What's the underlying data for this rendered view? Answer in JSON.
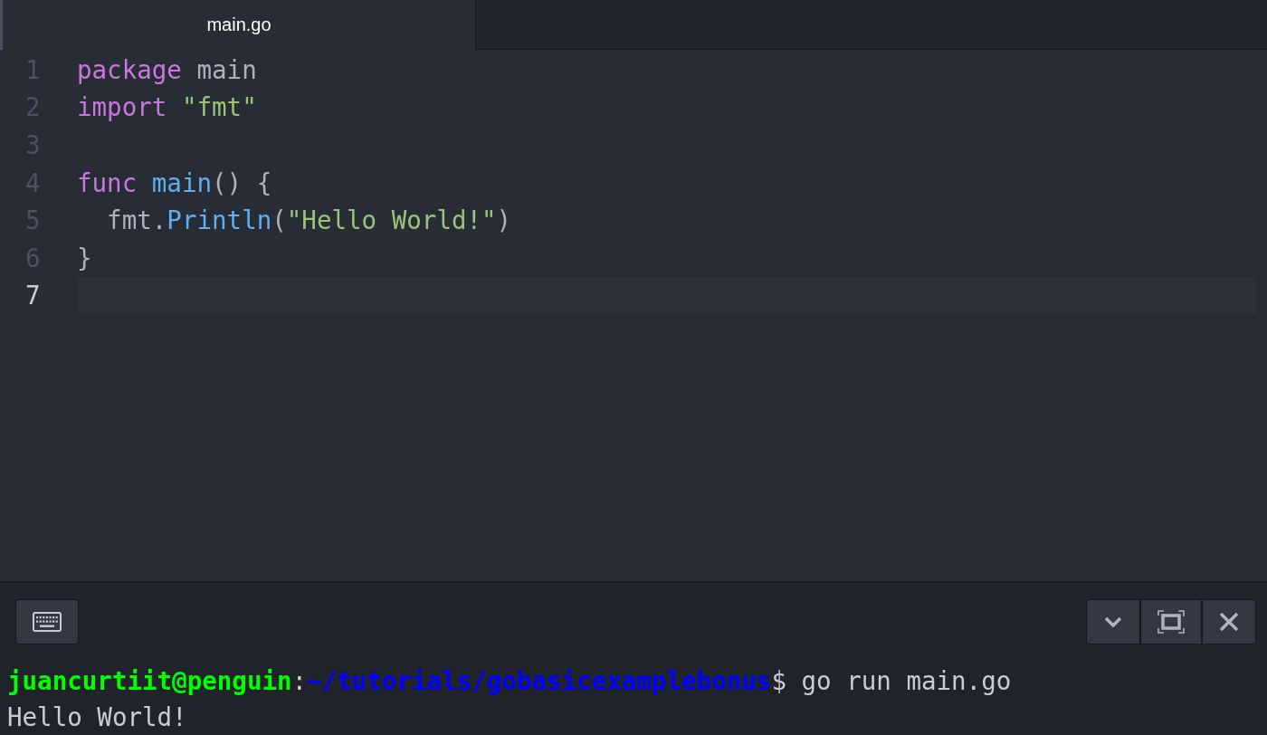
{
  "tabs": [
    {
      "label": "main.go",
      "selected": true
    }
  ],
  "editor": {
    "lines": [
      {
        "number": "1",
        "current": false,
        "tokens": [
          {
            "kind": "keyword",
            "text": "package"
          },
          {
            "kind": "plain",
            "text": " main"
          }
        ]
      },
      {
        "number": "2",
        "current": false,
        "tokens": [
          {
            "kind": "keyword",
            "text": "import "
          },
          {
            "kind": "string",
            "text": "\"fmt\""
          }
        ]
      },
      {
        "number": "3",
        "current": false
      },
      {
        "number": "4",
        "current": false,
        "tokens": [
          {
            "kind": "keyword",
            "text": "func "
          },
          {
            "kind": "function",
            "text": "main"
          },
          {
            "kind": "plain",
            "text": "() {"
          }
        ]
      },
      {
        "number": "5",
        "current": false,
        "tokens": [
          {
            "kind": "plain",
            "text": "  fmt."
          },
          {
            "kind": "function",
            "text": "Println"
          },
          {
            "kind": "plain",
            "text": "("
          },
          {
            "kind": "string",
            "text": "\"Hello World!\""
          },
          {
            "kind": "plain",
            "text": ")"
          }
        ]
      },
      {
        "number": "6",
        "current": false,
        "tokens": [
          {
            "kind": "plain",
            "text": "}"
          }
        ]
      },
      {
        "number": "7",
        "current": true
      }
    ]
  },
  "terminal": {
    "lines": [
      {
        "segments": [
          {
            "kind": "user",
            "text": "juancurtiit@penguin"
          },
          {
            "kind": "plain",
            "text": ":"
          },
          {
            "kind": "path",
            "text": "~/tutorials/gobasicexamplebonus"
          },
          {
            "kind": "plain",
            "text": "$ go run main.go"
          }
        ]
      },
      {
        "segments": [
          {
            "kind": "plain",
            "text": "Hello World!"
          }
        ]
      }
    ]
  }
}
